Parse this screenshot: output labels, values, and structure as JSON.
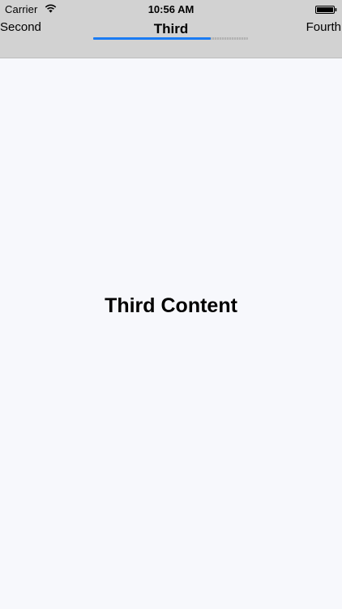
{
  "status_bar": {
    "carrier": "Carrier",
    "time": "10:56 AM",
    "wifi_icon": "wifi-icon",
    "battery_icon": "battery-icon"
  },
  "pager": {
    "previous_tab": "Second",
    "current_tab": "Third",
    "next_tab": "Fourth",
    "indicator_progress": 0.76,
    "indicator_color": "#1a7bf3"
  },
  "content": {
    "title": "Third Content",
    "background": "#f7f8fc"
  }
}
